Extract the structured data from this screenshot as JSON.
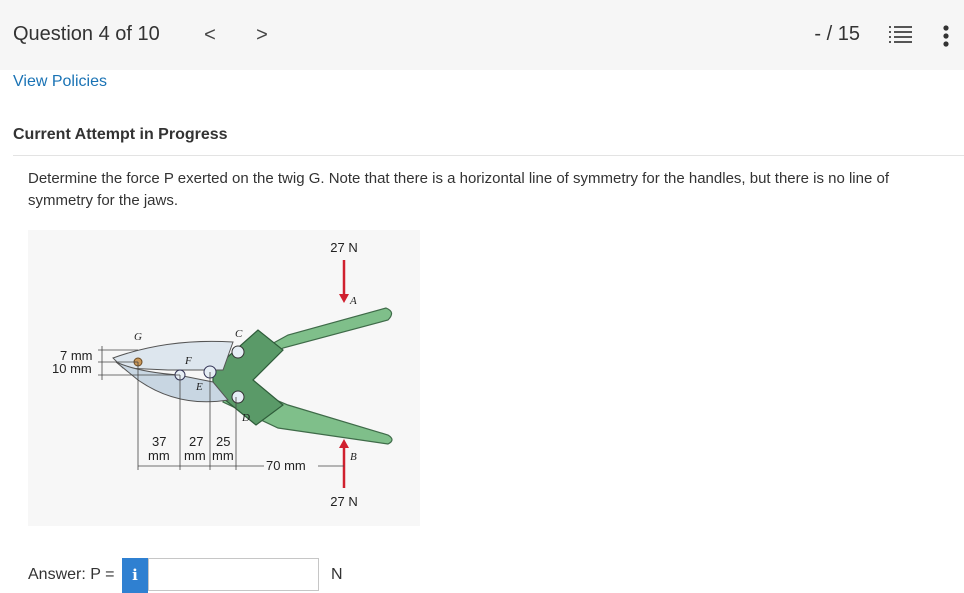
{
  "header": {
    "question_label": "Question 4 of 10",
    "prev": "<",
    "next": ">",
    "score": "- / 15"
  },
  "links": {
    "view_policies": "View Policies"
  },
  "status": {
    "attempt": "Current Attempt in Progress"
  },
  "question": {
    "prompt": "Determine the force P exerted on the twig G. Note that there is a horizontal line of symmetry for the handles, but there is no line of symmetry for the jaws."
  },
  "figure": {
    "force_top": "27 N",
    "force_bottom": "27 N",
    "points": {
      "a": "A",
      "b": "B",
      "c": "C",
      "d": "D",
      "e": "E",
      "f": "F",
      "g": "G"
    },
    "dims": {
      "d7": "7 mm",
      "d10": "10 mm",
      "d37_num": "37",
      "d27_num": "27",
      "d25_num": "25",
      "mm1": "mm",
      "mm2": "mm",
      "mm3": "mm",
      "d70": "70 mm"
    },
    "colors": {
      "handle": "#7fbf8a",
      "jaw": "#c8d6e2",
      "force": "#d0202e"
    }
  },
  "answer": {
    "label": "Answer: P =",
    "info": "i",
    "value": "",
    "unit": "N"
  },
  "icons": {
    "list": "list-icon",
    "more": "more-vertical-icon"
  }
}
